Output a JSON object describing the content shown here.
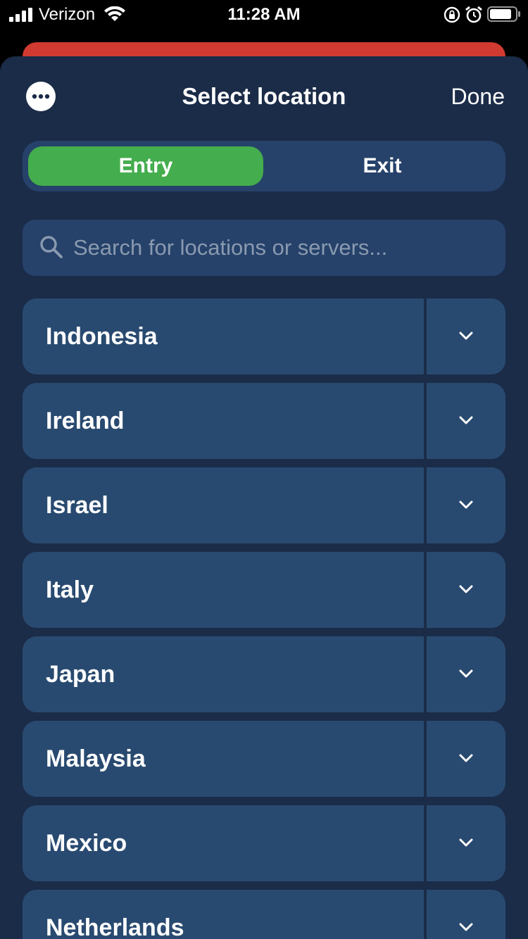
{
  "status_bar": {
    "carrier": "Verizon",
    "time": "11:28 AM",
    "icons": [
      "signal-icon",
      "wifi-icon",
      "orientation-lock-icon",
      "alarm-icon",
      "battery-icon"
    ]
  },
  "header": {
    "title": "Select location",
    "done_label": "Done",
    "more_icon": "more-icon"
  },
  "segmented": {
    "entry_label": "Entry",
    "exit_label": "Exit",
    "selected": "Entry"
  },
  "search": {
    "placeholder": "Search for locations or servers...",
    "value": ""
  },
  "locations": [
    {
      "name": "Indonesia"
    },
    {
      "name": "Ireland"
    },
    {
      "name": "Israel"
    },
    {
      "name": "Italy"
    },
    {
      "name": "Japan"
    },
    {
      "name": "Malaysia"
    },
    {
      "name": "Mexico"
    },
    {
      "name": "Netherlands"
    }
  ],
  "colors": {
    "sheet_bg": "#1b2c48",
    "row_bg": "#294a70",
    "accent_green": "#44ad4d",
    "behind_card_red": "#d13a30"
  }
}
